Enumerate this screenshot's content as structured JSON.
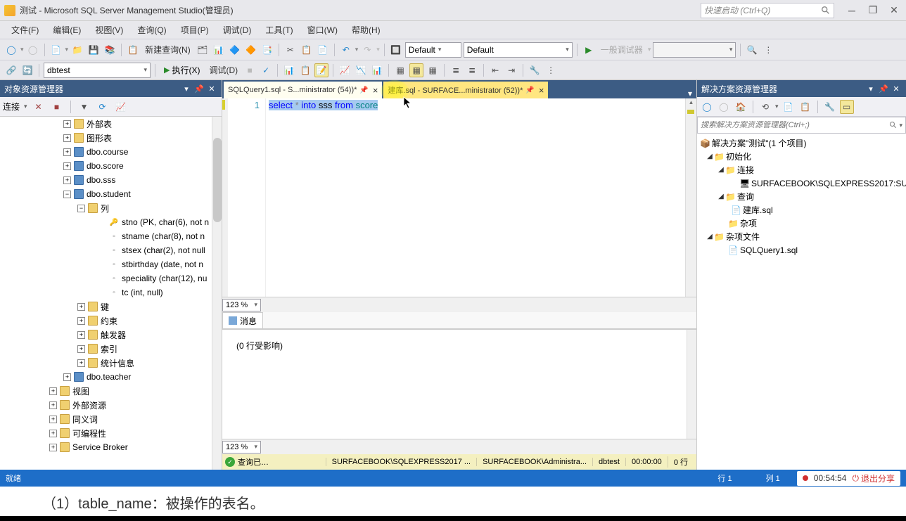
{
  "titlebar": {
    "title": "测试 - Microsoft SQL Server Management Studio(管理员)",
    "quick_launch_placeholder": "快速启动 (Ctrl+Q)"
  },
  "menu": {
    "file": "文件(F)",
    "edit": "编辑(E)",
    "view": "视图(V)",
    "query": "查询(Q)",
    "project": "项目(P)",
    "debug": "调试(D)",
    "tools": "工具(T)",
    "window": "窗口(W)",
    "help": "帮助(H)"
  },
  "toolbar1": {
    "new_query": "新建查询(N)",
    "config1": "Default",
    "config2": "Default",
    "debugger": "一般调试器"
  },
  "toolbar2": {
    "db": "dbtest",
    "execute": "执行(X)",
    "debug": "调试(D)"
  },
  "obj_explorer": {
    "title": "对象资源管理器",
    "connect": "连接"
  },
  "tree": {
    "external_tables": "外部表",
    "graph_tables": "图形表",
    "course": "dbo.course",
    "score": "dbo.score",
    "sss": "dbo.sss",
    "student": "dbo.student",
    "cols": "列",
    "stno": "stno (PK, char(6), not n",
    "stname": "stname (char(8), not n",
    "stsex": "stsex (char(2), not null",
    "stbirthday": "stbirthday (date, not n",
    "speciality": "speciality (char(12), nu",
    "tc": "tc (int, null)",
    "keys": "键",
    "constraints": "约束",
    "triggers": "触发器",
    "indexes": "索引",
    "stats": "统计信息",
    "teacher": "dbo.teacher",
    "views": "视图",
    "ext_res": "外部资源",
    "synonyms": "同义词",
    "programmability": "可编程性",
    "service_broker": "Service Broker"
  },
  "tabs": {
    "tab1": "SQLQuery1.sql - S...ministrator (54))*",
    "tab2": "建库.sql - SURFACE...ministrator (52))*"
  },
  "editor": {
    "line_no": "1",
    "sql": {
      "p1": "select",
      "p2": " * ",
      "p3": "into",
      "p4": " sss ",
      "p5": "from",
      "p6": " score"
    },
    "zoom": "123 %"
  },
  "messages": {
    "tab_label": "消息",
    "body": "(0 行受影响)",
    "zoom": "123 %"
  },
  "exec_status": {
    "status": "查询已…",
    "server": "SURFACEBOOK\\SQLEXPRESS2017 ...",
    "user": "SURFACEBOOK\\Administra...",
    "db": "dbtest",
    "time": "00:00:00",
    "rows": "0 行"
  },
  "sln": {
    "title": "解决方案资源管理器",
    "search_placeholder": "搜索解决方案资源管理器(Ctrl+;)",
    "root": "解决方案\"测试\"(1 个项目)",
    "init": "初始化",
    "conn": "连接",
    "server_node": "SURFACEBOOK\\SQLEXPRESS2017:SU",
    "query_folder": "查询",
    "create_db": "建库.sql",
    "misc": "杂项",
    "misc_files": "杂项文件",
    "sqlquery1": "SQLQuery1.sql"
  },
  "statusbar": {
    "ready": "就绪",
    "line": "行 1",
    "col": "列 1"
  },
  "recording": {
    "time": "00:54:54",
    "exit": "退出分享"
  },
  "footer": "（1）table_name：被操作的表名。"
}
